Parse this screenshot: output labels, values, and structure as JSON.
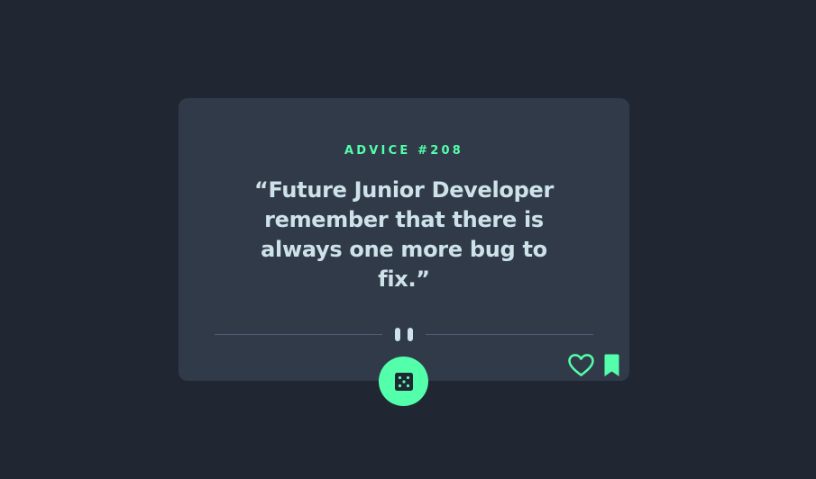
{
  "card": {
    "advice_label": "ADVICE #208",
    "quote": "“Future Junior Developer remember that there is always one more bug to fix.”"
  },
  "controls": {
    "divider_icon": "pause-icon",
    "generate_icon": "dice-icon",
    "like_icon": "heart-outline-icon",
    "save_icon": "bookmark-icon"
  },
  "colors": {
    "background": "#202733",
    "card": "#313a49",
    "accent": "#53ffaa",
    "text": "#cee3e9",
    "divider": "#4f5d74"
  }
}
